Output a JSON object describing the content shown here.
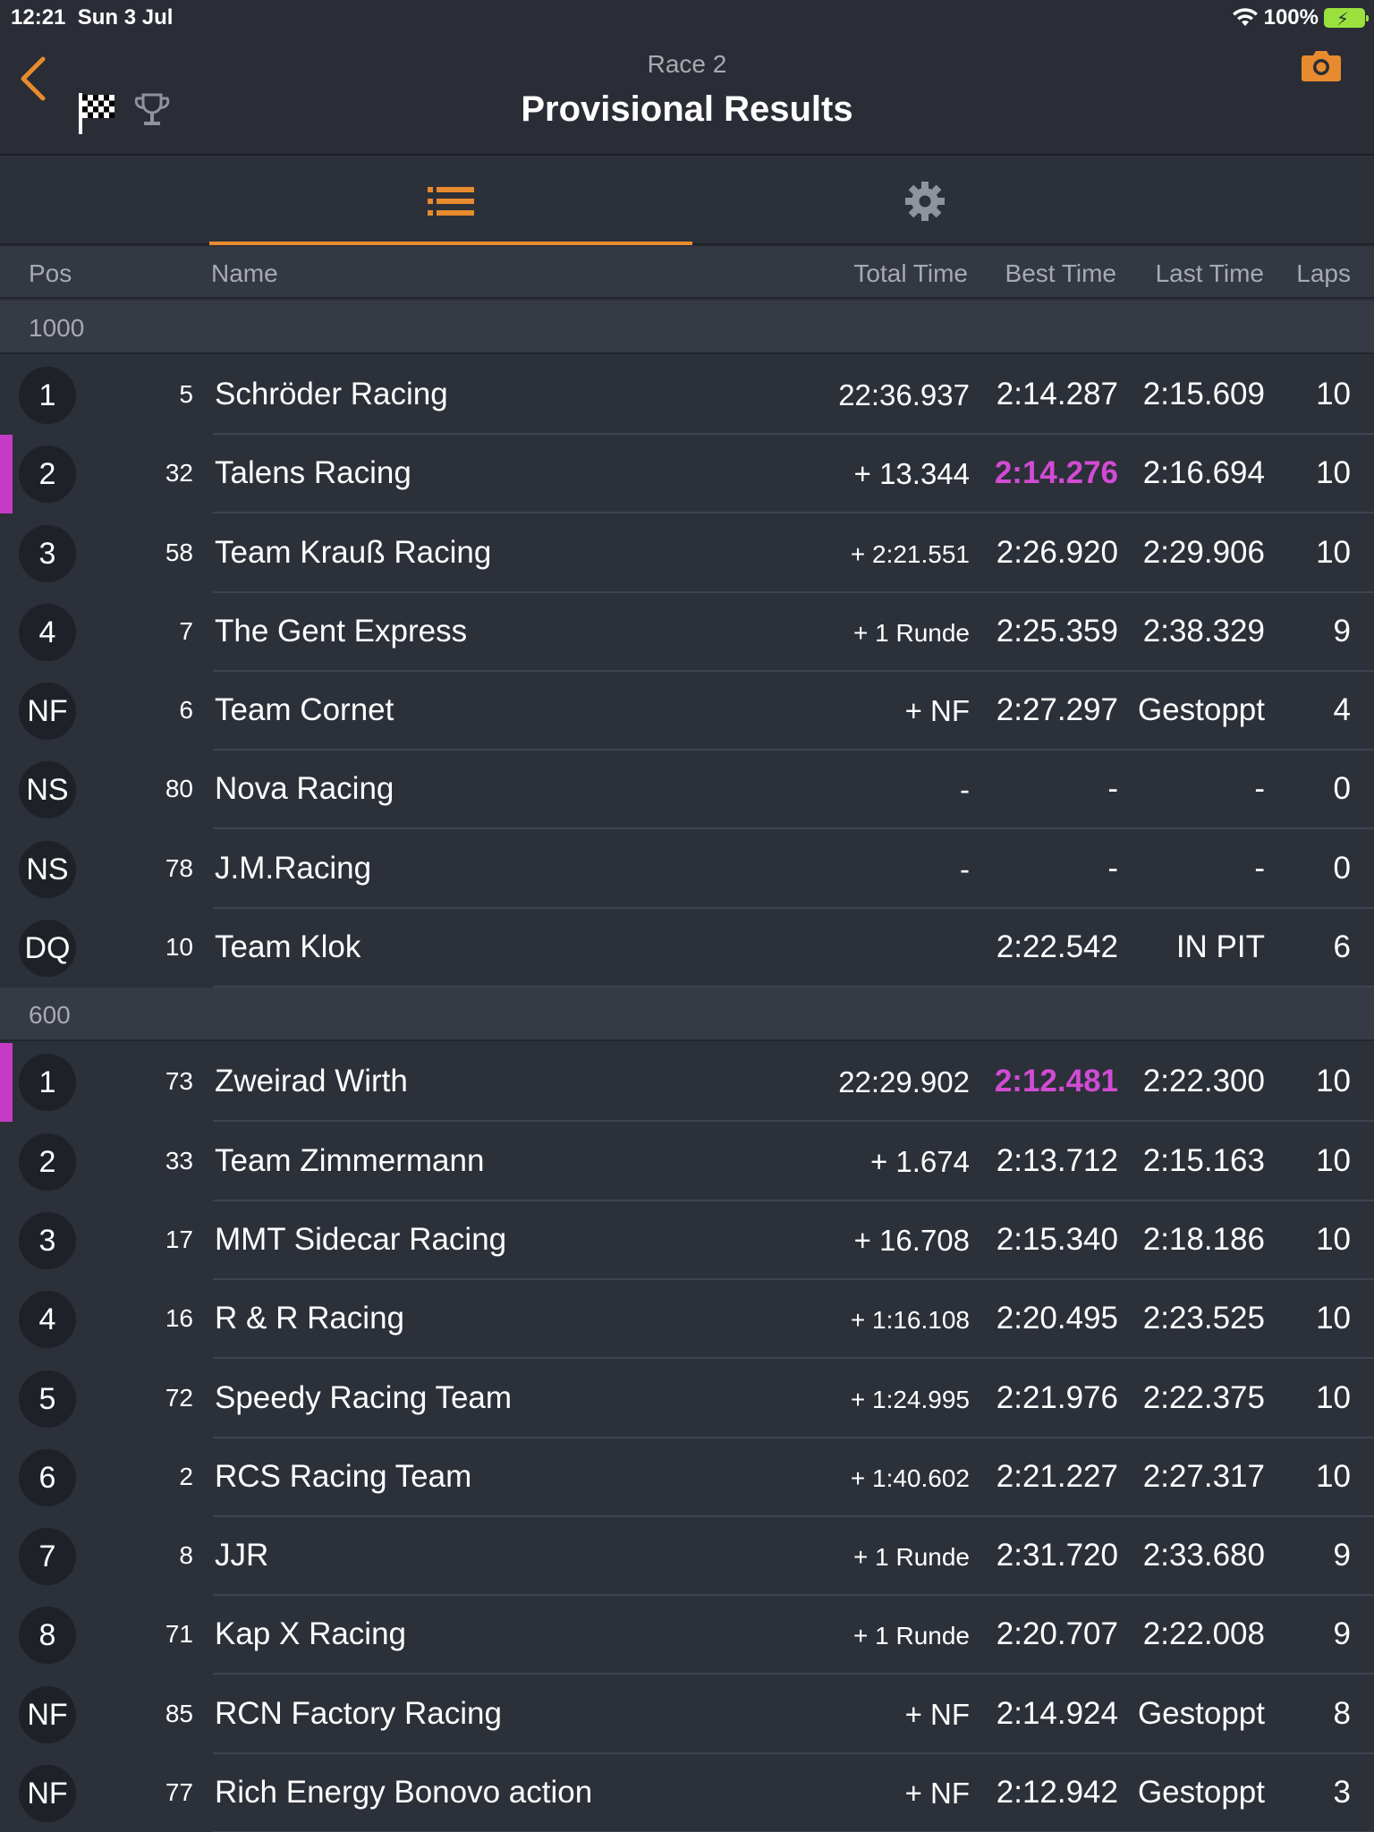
{
  "status_bar": {
    "time": "12:21",
    "date": "Sun 3 Jul",
    "battery": "100%"
  },
  "header": {
    "subtitle": "Race 2",
    "title": "Provisional Results"
  },
  "columns": {
    "pos": "Pos",
    "name": "Name",
    "total": "Total Time",
    "best": "Best Time",
    "last": "Last Time",
    "laps": "Laps"
  },
  "colors": {
    "accent": "#e88b2e",
    "fastest": "#d24bd4",
    "battery": "#9be13e"
  },
  "sections": [
    {
      "label": "1000",
      "rows": [
        {
          "pos": "1",
          "num": "5",
          "name": "Schröder Racing",
          "total": "22:36.937",
          "best": "2:14.287",
          "last": "2:15.609",
          "laps": "10",
          "fastest": false
        },
        {
          "pos": "2",
          "num": "32",
          "name": "Talens Racing",
          "total": "+ 13.344",
          "best": "2:14.276",
          "last": "2:16.694",
          "laps": "10",
          "fastest": true
        },
        {
          "pos": "3",
          "num": "58",
          "name": "Team Krauß Racing",
          "total": "+ 2:21.551",
          "best": "2:26.920",
          "last": "2:29.906",
          "laps": "10",
          "fastest": false
        },
        {
          "pos": "4",
          "num": "7",
          "name": "The Gent Express",
          "total": "+ 1 Runde",
          "best": "2:25.359",
          "last": "2:38.329",
          "laps": "9",
          "fastest": false
        },
        {
          "pos": "NF",
          "num": "6",
          "name": "Team Cornet",
          "total": "+ NF",
          "best": "2:27.297",
          "last": "Gestoppt",
          "laps": "4",
          "fastest": false
        },
        {
          "pos": "NS",
          "num": "80",
          "name": "Nova Racing",
          "total": "-",
          "best": "-",
          "last": "-",
          "laps": "0",
          "fastest": false
        },
        {
          "pos": "NS",
          "num": "78",
          "name": "J.M.Racing",
          "total": "-",
          "best": "-",
          "last": "-",
          "laps": "0",
          "fastest": false
        },
        {
          "pos": "DQ",
          "num": "10",
          "name": "Team Klok",
          "total": "",
          "best": "2:22.542",
          "last": "IN PIT",
          "laps": "6",
          "fastest": false
        }
      ]
    },
    {
      "label": "600",
      "rows": [
        {
          "pos": "1",
          "num": "73",
          "name": "Zweirad Wirth",
          "total": "22:29.902",
          "best": "2:12.481",
          "last": "2:22.300",
          "laps": "10",
          "fastest": true
        },
        {
          "pos": "2",
          "num": "33",
          "name": "Team Zimmermann",
          "total": "+ 1.674",
          "best": "2:13.712",
          "last": "2:15.163",
          "laps": "10",
          "fastest": false
        },
        {
          "pos": "3",
          "num": "17",
          "name": "MMT Sidecar Racing",
          "total": "+ 16.708",
          "best": "2:15.340",
          "last": "2:18.186",
          "laps": "10",
          "fastest": false
        },
        {
          "pos": "4",
          "num": "16",
          "name": "R & R Racing",
          "total": "+ 1:16.108",
          "best": "2:20.495",
          "last": "2:23.525",
          "laps": "10",
          "fastest": false
        },
        {
          "pos": "5",
          "num": "72",
          "name": "Speedy Racing Team",
          "total": "+ 1:24.995",
          "best": "2:21.976",
          "last": "2:22.375",
          "laps": "10",
          "fastest": false
        },
        {
          "pos": "6",
          "num": "2",
          "name": "RCS Racing Team",
          "total": "+ 1:40.602",
          "best": "2:21.227",
          "last": "2:27.317",
          "laps": "10",
          "fastest": false
        },
        {
          "pos": "7",
          "num": "8",
          "name": "JJR",
          "total": "+ 1 Runde",
          "best": "2:31.720",
          "last": "2:33.680",
          "laps": "9",
          "fastest": false
        },
        {
          "pos": "8",
          "num": "71",
          "name": "Kap X Racing",
          "total": "+ 1 Runde",
          "best": "2:20.707",
          "last": "2:22.008",
          "laps": "9",
          "fastest": false
        },
        {
          "pos": "NF",
          "num": "85",
          "name": "RCN Factory Racing",
          "total": "+ NF",
          "best": "2:14.924",
          "last": "Gestoppt",
          "laps": "8",
          "fastest": false
        },
        {
          "pos": "NF",
          "num": "77",
          "name": "Rich Energy Bonovo action",
          "total": "+ NF",
          "best": "2:12.942",
          "last": "Gestoppt",
          "laps": "3",
          "fastest": false
        }
      ]
    }
  ]
}
